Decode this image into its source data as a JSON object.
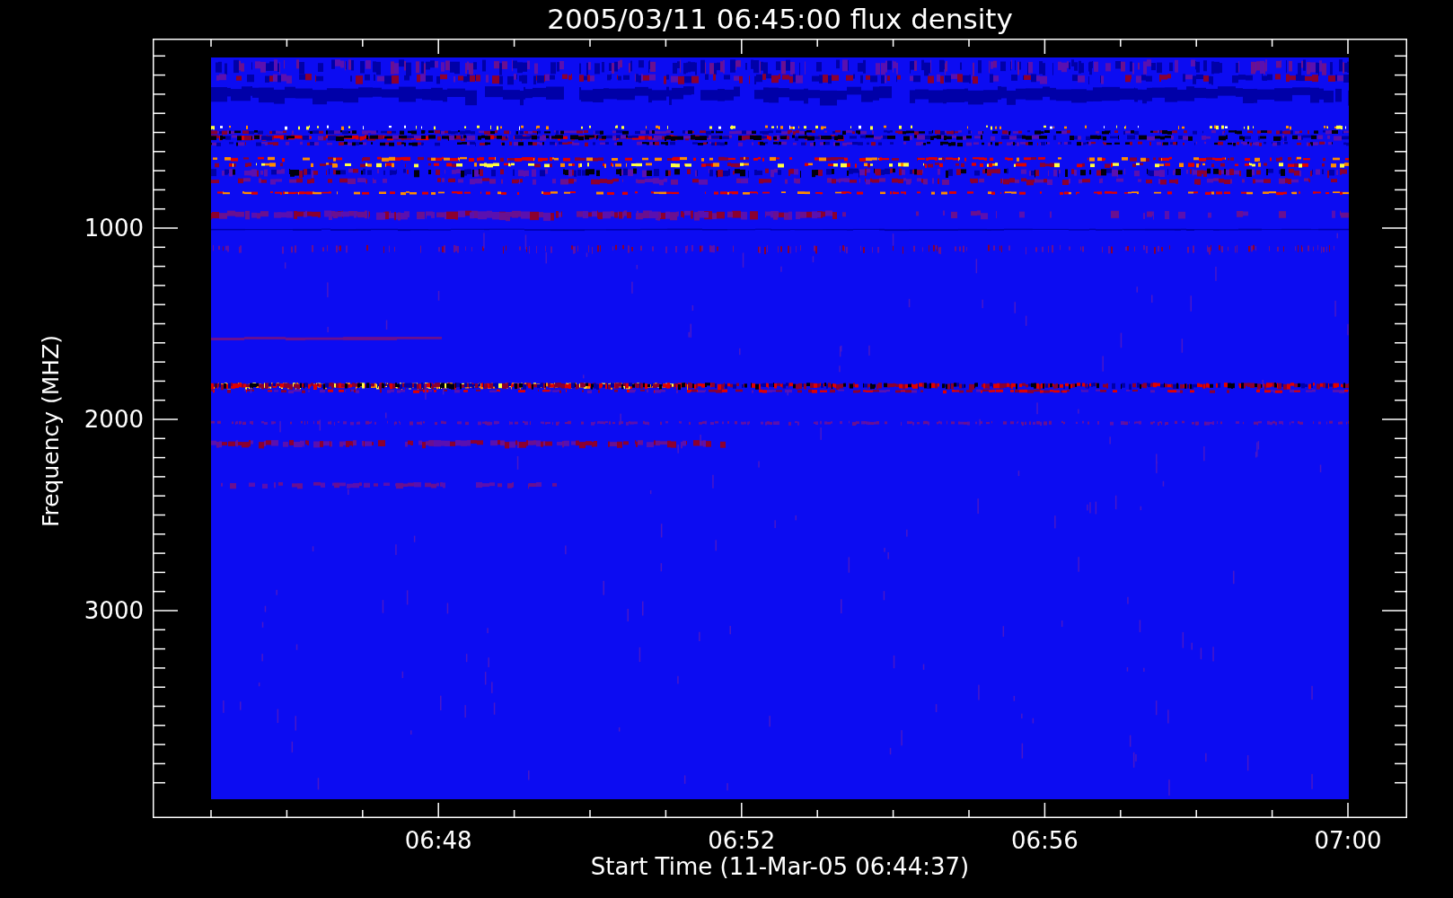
{
  "title": "2005/03/11 06:45:00 flux density",
  "y_axis": {
    "label": "Frequency (MHZ)",
    "ticks": [
      "1000",
      "2000",
      "3000"
    ]
  },
  "x_axis": {
    "label": "Start Time (11-Mar-05 06:44:37)",
    "ticks": [
      "06:48",
      "06:52",
      "06:56",
      "07:00"
    ]
  }
}
